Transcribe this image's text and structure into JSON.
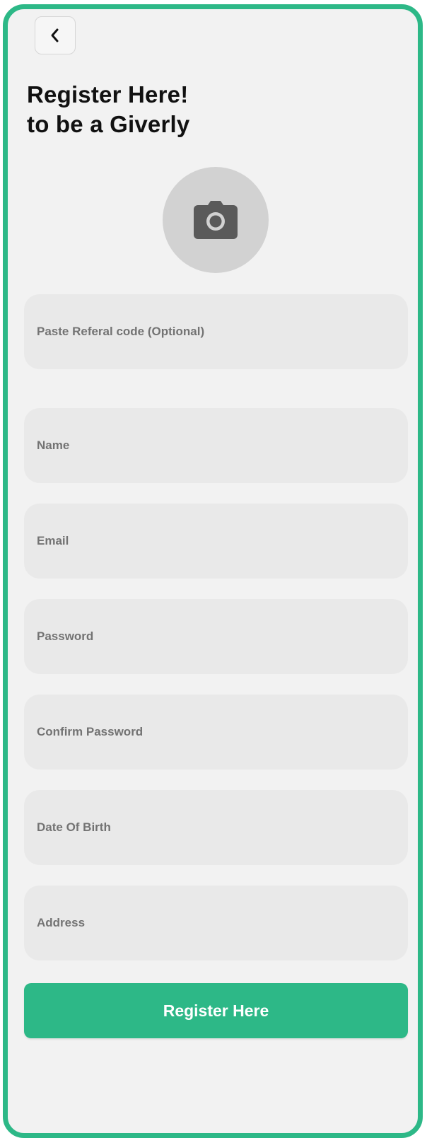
{
  "colors": {
    "accent": "#2db887",
    "background": "#f2f2f2",
    "field_background": "#e9e9e9",
    "avatar_background": "#d2d2d2",
    "title_text": "#111111",
    "placeholder_text": "#737373"
  },
  "header": {
    "back_icon": "chevron-left-icon",
    "title_line1": "Register Here!",
    "title_line2": "to be a Giverly"
  },
  "avatar": {
    "icon": "camera-icon"
  },
  "form": {
    "referral_placeholder": "Paste Referal code (Optional)",
    "name_placeholder": "Name",
    "email_placeholder": "Email",
    "password_placeholder": "Password",
    "confirm_password_placeholder": "Confirm Password",
    "dob_placeholder": "Date Of Birth",
    "address_placeholder": "Address",
    "submit_label": "Register Here"
  }
}
